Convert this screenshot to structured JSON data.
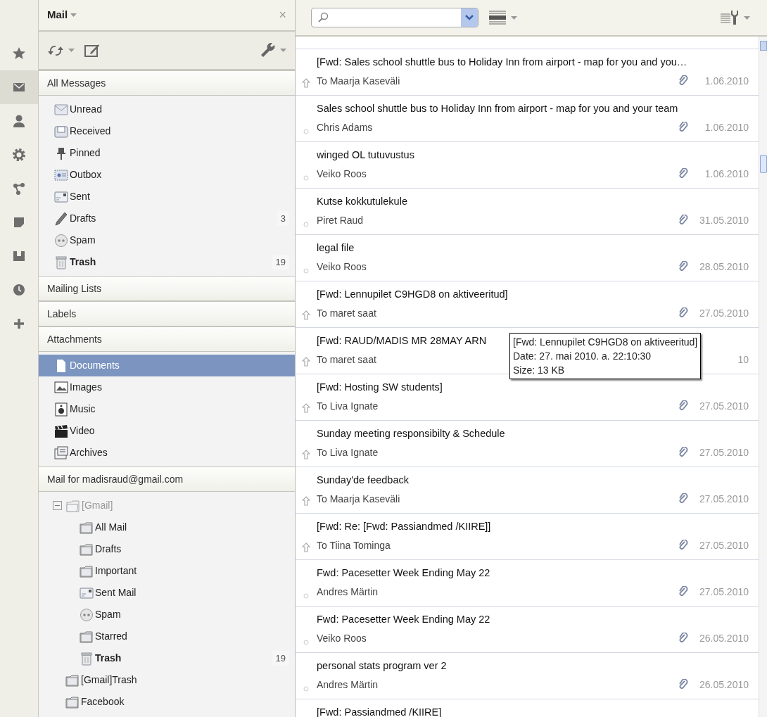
{
  "rail": [
    {
      "kind": "star",
      "selected": false
    },
    {
      "kind": "mail",
      "selected": true
    },
    {
      "kind": "person",
      "selected": false
    },
    {
      "kind": "gear",
      "selected": false
    },
    {
      "kind": "share",
      "selected": false
    },
    {
      "kind": "note",
      "selected": false
    },
    {
      "kind": "bin",
      "selected": false
    },
    {
      "kind": "clock",
      "selected": false
    },
    {
      "kind": "plus",
      "selected": false
    }
  ],
  "sidebar": {
    "title": "Mail",
    "close": "×",
    "sections": [
      {
        "title": "All Messages",
        "items": [
          {
            "label": "Unread",
            "kind": "envelope",
            "unread": false,
            "selected": false
          },
          {
            "label": "Received",
            "kind": "tray",
            "unread": false,
            "selected": false
          },
          {
            "label": "Pinned",
            "kind": "pin",
            "unread": false,
            "selected": false
          },
          {
            "label": "Outbox",
            "kind": "outbox",
            "unread": false,
            "selected": false
          },
          {
            "label": "Sent",
            "kind": "card",
            "unread": false,
            "selected": false
          },
          {
            "label": "Drafts",
            "kind": "pencil",
            "count": "3",
            "unread": false,
            "selected": false
          },
          {
            "label": "Spam",
            "kind": "face",
            "unread": false,
            "selected": false
          },
          {
            "label": "Trash",
            "kind": "trash",
            "count": "19",
            "unread": true,
            "selected": false
          }
        ]
      },
      {
        "title": "Mailing Lists"
      },
      {
        "title": "Labels"
      },
      {
        "title": "Attachments",
        "items": [
          {
            "label": "Documents",
            "kind": "document",
            "unread": false,
            "selected": true
          },
          {
            "label": "Images",
            "kind": "image",
            "unread": false,
            "selected": false
          },
          {
            "label": "Music",
            "kind": "speaker",
            "unread": false,
            "selected": false
          },
          {
            "label": "Video",
            "kind": "clapper",
            "unread": false,
            "selected": false
          },
          {
            "label": "Archives",
            "kind": "archive",
            "unread": false,
            "selected": false
          }
        ]
      },
      {
        "title": "Mail for madisraud@gmail.com",
        "items": [
          {
            "label": "[Gmail]",
            "kind": "folder-open",
            "unread": false,
            "selected": false,
            "disabled": true,
            "expanded": true,
            "children": [
              {
                "label": "All Mail",
                "kind": "folder",
                "unread": false,
                "selected": false,
                "disabled": false
              },
              {
                "label": "Drafts",
                "kind": "folder",
                "unread": false,
                "selected": false,
                "disabled": false
              },
              {
                "label": "Important",
                "kind": "folder",
                "unread": false,
                "selected": false,
                "disabled": false
              },
              {
                "label": "Sent Mail",
                "kind": "card",
                "unread": false,
                "selected": false,
                "disabled": false
              },
              {
                "label": "Spam",
                "kind": "face",
                "unread": false,
                "selected": false,
                "disabled": false
              },
              {
                "label": "Starred",
                "kind": "folder",
                "unread": false,
                "selected": false,
                "disabled": false
              },
              {
                "label": "Trash",
                "kind": "trash",
                "count": "19",
                "unread": true,
                "selected": false,
                "disabled": false
              }
            ]
          },
          {
            "label": "[Gmail]Trash",
            "kind": "folder",
            "unread": false,
            "selected": false,
            "disabled": false
          },
          {
            "label": "Facebook",
            "kind": "folder",
            "unread": false,
            "selected": false,
            "disabled": false
          }
        ]
      }
    ]
  },
  "messages": [
    {
      "subject": "[Fwd: Sales school shuttle bus to Holiday Inn from airport - map for you and you…",
      "sender": "To Maarja Kaseväli",
      "date": "1.06.2010",
      "kind": "forwarded",
      "attachment": true
    },
    {
      "subject": "Sales school shuttle bus to Holiday Inn from airport - map for you and your team",
      "sender": "Chris Adams",
      "date": "1.06.2010",
      "kind": "read",
      "attachment": true
    },
    {
      "subject": "winged OL tutuvustus",
      "sender": "Veiko Roos",
      "date": "1.06.2010",
      "kind": "read",
      "attachment": true
    },
    {
      "subject": "Kutse kokkutulekule",
      "sender": "Piret Raud",
      "date": "31.05.2010",
      "kind": "read",
      "attachment": true
    },
    {
      "subject": "legal file",
      "sender": "Veiko Roos",
      "date": "28.05.2010",
      "kind": "read",
      "attachment": true
    },
    {
      "subject": "[Fwd: Lennupilet C9HGD8 on aktiveeritud]",
      "sender": "To maret saat",
      "date": "27.05.2010",
      "kind": "forwarded",
      "attachment": true
    },
    {
      "subject": "[Fwd: RAUD/MADIS MR 28MAY ARN",
      "sender": "To maret saat",
      "date": "10",
      "kind": "forwarded"
    },
    {
      "subject": "[Fwd: Hosting SW students]",
      "sender": "To Liva Ignate",
      "date": "27.05.2010",
      "kind": "forwarded",
      "attachment": true
    },
    {
      "subject": "Sunday meeting responsibilty & Schedule",
      "sender": "To Liva Ignate",
      "date": "27.05.2010",
      "kind": "forwarded",
      "attachment": true
    },
    {
      "subject": "Sunday'de feedback",
      "sender": "To Maarja Kaseväli",
      "date": "27.05.2010",
      "kind": "forwarded",
      "attachment": true
    },
    {
      "subject": "[Fwd: Re: [Fwd: Passiandmed /KIIRE]]",
      "sender": "To Tiina Tominga",
      "date": "27.05.2010",
      "kind": "forwarded",
      "attachment": true
    },
    {
      "subject": "Fwd: Pacesetter Week Ending May 22",
      "sender": "Andres Märtin",
      "date": "27.05.2010",
      "kind": "read",
      "attachment": true
    },
    {
      "subject": "Fwd: Pacesetter Week Ending May 22",
      "sender": "Veiko Roos",
      "date": "26.05.2010",
      "kind": "read",
      "attachment": true
    },
    {
      "subject": "personal stats program ver 2",
      "sender": "Andres Märtin",
      "date": "26.05.2010",
      "kind": "read",
      "attachment": true
    },
    {
      "subject": "[Fwd: Passiandmed /KIIRE]"
    }
  ],
  "tooltip": {
    "lines": [
      "[Fwd: Lennupilet C9HGD8 on aktiveeritud]",
      "Date: 27. mai 2010. a. 22:10:30",
      "Size: 13 KB"
    ]
  }
}
